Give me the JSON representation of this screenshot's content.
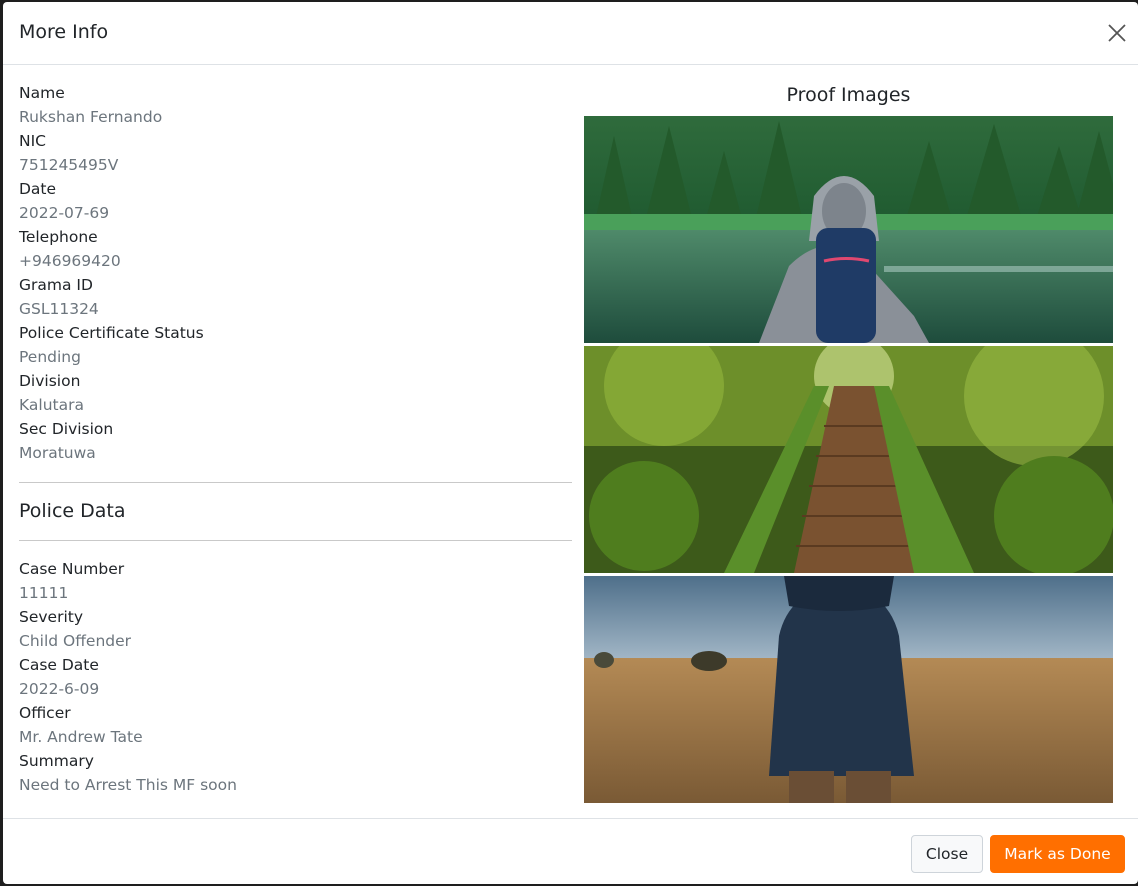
{
  "modal": {
    "title": "More Info",
    "close_icon": "close-icon"
  },
  "person": [
    {
      "label": "Name",
      "value": "Rukshan Fernando"
    },
    {
      "label": "NIC",
      "value": "751245495V"
    },
    {
      "label": "Date",
      "value": "2022-07-69"
    },
    {
      "label": "Telephone",
      "value": "+946969420"
    },
    {
      "label": "Grama ID",
      "value": "GSL11324"
    },
    {
      "label": "Police Certificate Status",
      "value": "Pending"
    },
    {
      "label": "Division",
      "value": "Kalutara"
    },
    {
      "label": "Sec Division",
      "value": "Moratuwa"
    }
  ],
  "police": {
    "title": "Police Data",
    "fields": [
      {
        "label": "Case Number",
        "value": "11111"
      },
      {
        "label": "Severity",
        "value": "Child Offender"
      },
      {
        "label": "Case Date",
        "value": "2022-6-09"
      },
      {
        "label": "Officer",
        "value": "Mr. Andrew Tate"
      },
      {
        "label": "Summary",
        "value": "Need to Arrest This MF soon"
      }
    ]
  },
  "proof": {
    "title": "Proof Images"
  },
  "footer": {
    "close_label": "Close",
    "done_label": "Mark as Done",
    "accent": "#ff6f00"
  }
}
